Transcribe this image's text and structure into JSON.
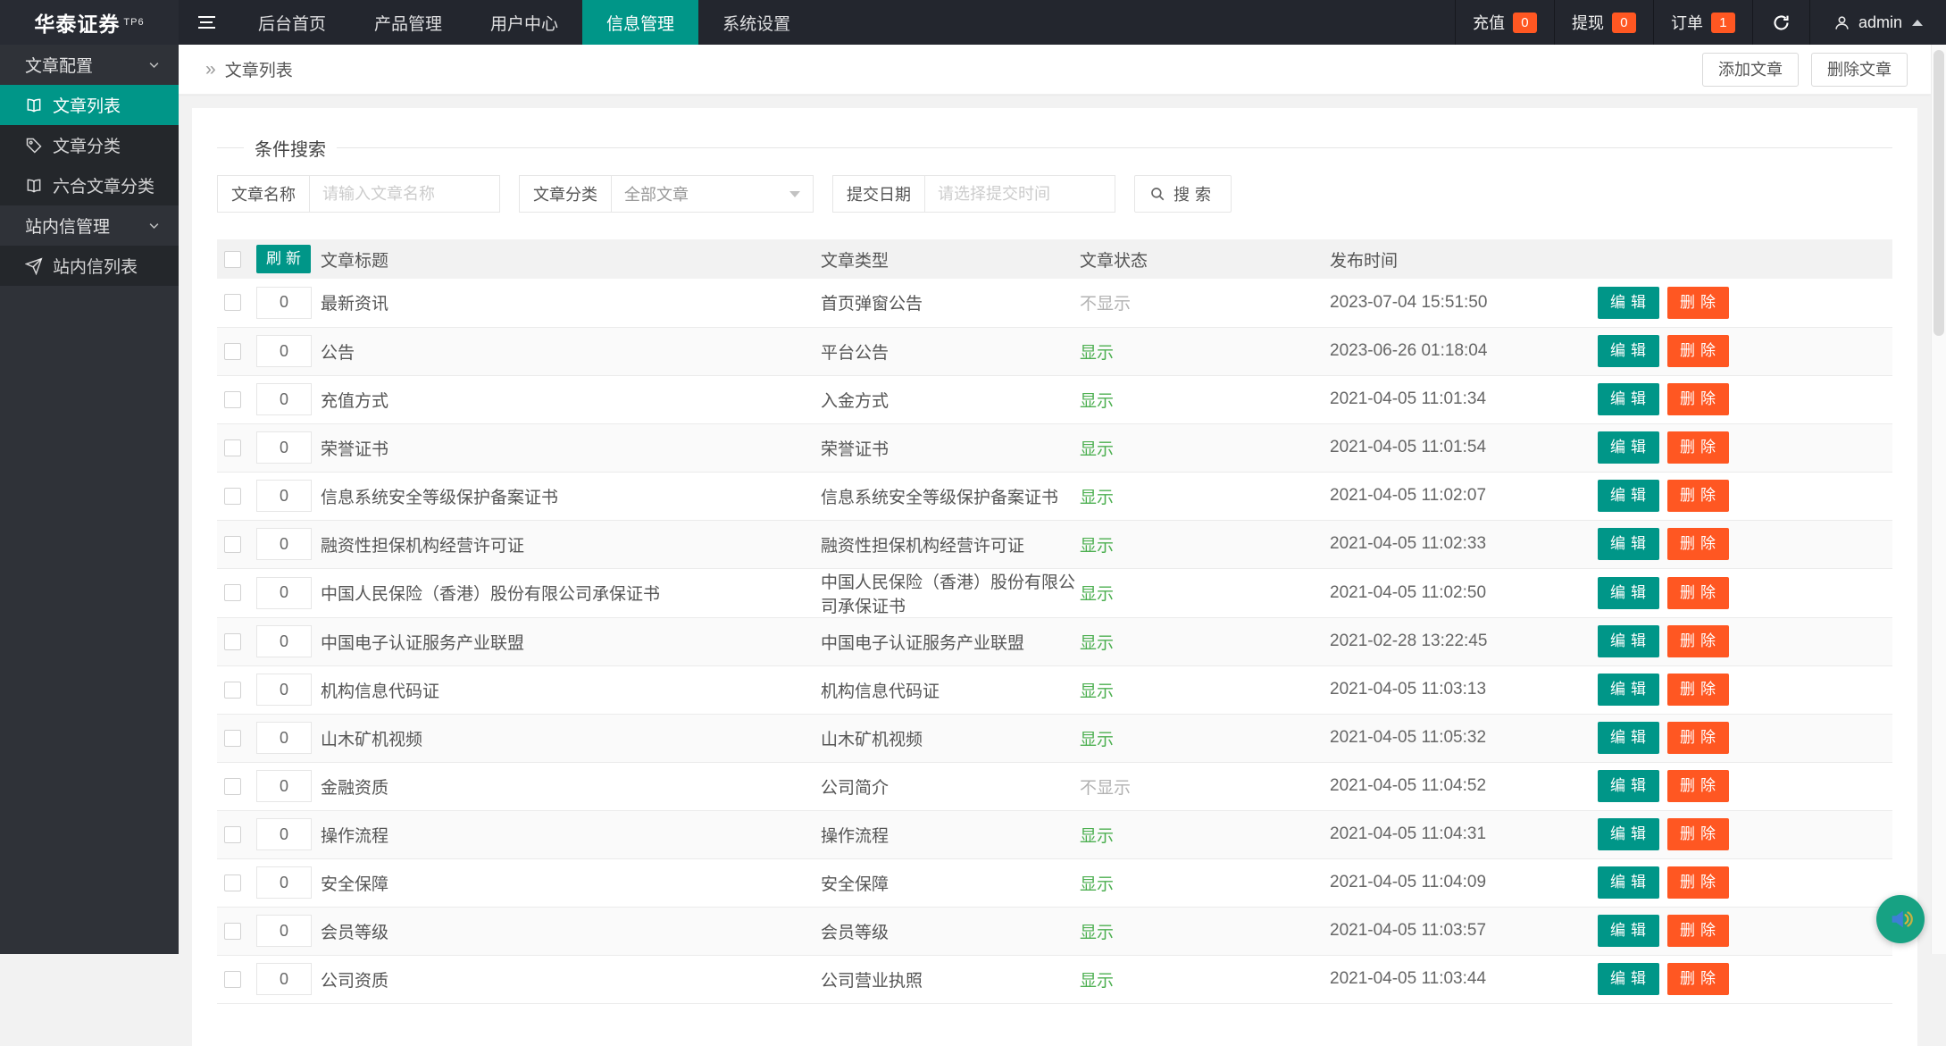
{
  "header": {
    "logo_text": "华泰证券",
    "logo_sup": "TP6",
    "nav": [
      {
        "name": "home",
        "label": "后台首页",
        "active": false
      },
      {
        "name": "products",
        "label": "产品管理",
        "active": false
      },
      {
        "name": "users",
        "label": "用户中心",
        "active": false
      },
      {
        "name": "info",
        "label": "信息管理",
        "active": true
      },
      {
        "name": "settings",
        "label": "系统设置",
        "active": false
      }
    ],
    "stats": [
      {
        "name": "recharge",
        "label": "充值",
        "badge": "0"
      },
      {
        "name": "withdraw",
        "label": "提现",
        "badge": "0"
      },
      {
        "name": "orders",
        "label": "订单",
        "badge": "1"
      }
    ],
    "user": "admin"
  },
  "sidebar": {
    "groups": [
      {
        "label": "文章配置",
        "items": [
          {
            "label": "文章列表",
            "icon": "book-icon",
            "active": true
          },
          {
            "label": "文章分类",
            "icon": "tag-icon",
            "active": false
          },
          {
            "label": "六合文章分类",
            "icon": "book-icon",
            "active": false
          }
        ]
      },
      {
        "label": "站内信管理",
        "items": [
          {
            "label": "站内信列表",
            "icon": "send-icon",
            "active": false
          }
        ]
      }
    ]
  },
  "breadcrumb": {
    "marker": "»",
    "title": "文章列表"
  },
  "page_actions": {
    "add_label": "添加文章",
    "delete_label": "删除文章"
  },
  "search": {
    "legend": "条件搜索",
    "name_label": "文章名称",
    "name_placeholder": "请输入文章名称",
    "category_label": "文章分类",
    "category_value": "全部文章",
    "date_label": "提交日期",
    "date_placeholder": "请选择提交时间",
    "button_label": "搜索"
  },
  "table": {
    "refresh_label": "刷新",
    "headers": [
      "文章标题",
      "文章类型",
      "文章状态",
      "发布时间"
    ],
    "edit_label": "编辑",
    "delete_label": "删除",
    "rows": [
      {
        "sort": "0",
        "title": "最新资讯",
        "type": "首页弹窗公告",
        "status": "不显示",
        "visible": false,
        "time": "2023-07-04 15:51:50"
      },
      {
        "sort": "0",
        "title": "公告",
        "type": "平台公告",
        "status": "显示",
        "visible": true,
        "time": "2023-06-26 01:18:04"
      },
      {
        "sort": "0",
        "title": "充值方式",
        "type": "入金方式",
        "status": "显示",
        "visible": true,
        "time": "2021-04-05 11:01:34"
      },
      {
        "sort": "0",
        "title": "荣誉证书",
        "type": "荣誉证书",
        "status": "显示",
        "visible": true,
        "time": "2021-04-05 11:01:54"
      },
      {
        "sort": "0",
        "title": "信息系统安全等级保护备案证书",
        "type": "信息系统安全等级保护备案证书",
        "status": "显示",
        "visible": true,
        "time": "2021-04-05 11:02:07"
      },
      {
        "sort": "0",
        "title": "融资性担保机构经营许可证",
        "type": "融资性担保机构经营许可证",
        "status": "显示",
        "visible": true,
        "time": "2021-04-05 11:02:33"
      },
      {
        "sort": "0",
        "title": "中国人民保险（香港）股份有限公司承保证书",
        "type": "中国人民保险（香港）股份有限公司承保证书",
        "status": "显示",
        "visible": true,
        "time": "2021-04-05 11:02:50"
      },
      {
        "sort": "0",
        "title": "中国电子认证服务产业联盟",
        "type": "中国电子认证服务产业联盟",
        "status": "显示",
        "visible": true,
        "time": "2021-02-28 13:22:45"
      },
      {
        "sort": "0",
        "title": "机构信息代码证",
        "type": "机构信息代码证",
        "status": "显示",
        "visible": true,
        "time": "2021-04-05 11:03:13"
      },
      {
        "sort": "0",
        "title": "山木矿机视频",
        "type": "山木矿机视频",
        "status": "显示",
        "visible": true,
        "time": "2021-04-05 11:05:32"
      },
      {
        "sort": "0",
        "title": "金融资质",
        "type": "公司简介",
        "status": "不显示",
        "visible": false,
        "time": "2021-04-05 11:04:52"
      },
      {
        "sort": "0",
        "title": "操作流程",
        "type": "操作流程",
        "status": "显示",
        "visible": true,
        "time": "2021-04-05 11:04:31"
      },
      {
        "sort": "0",
        "title": "安全保障",
        "type": "安全保障",
        "status": "显示",
        "visible": true,
        "time": "2021-04-05 11:04:09"
      },
      {
        "sort": "0",
        "title": "会员等级",
        "type": "会员等级",
        "status": "显示",
        "visible": true,
        "time": "2021-04-05 11:03:57"
      },
      {
        "sort": "0",
        "title": "公司资质",
        "type": "公司营业执照",
        "status": "显示",
        "visible": true,
        "time": "2021-04-05 11:03:44"
      }
    ]
  },
  "colors": {
    "accent": "#009688",
    "danger": "#FF5722",
    "status_show": "#4caf50",
    "status_hide": "#b2b2b2",
    "header_bg": "#23262E",
    "sidebar_bg": "#2F3238"
  }
}
